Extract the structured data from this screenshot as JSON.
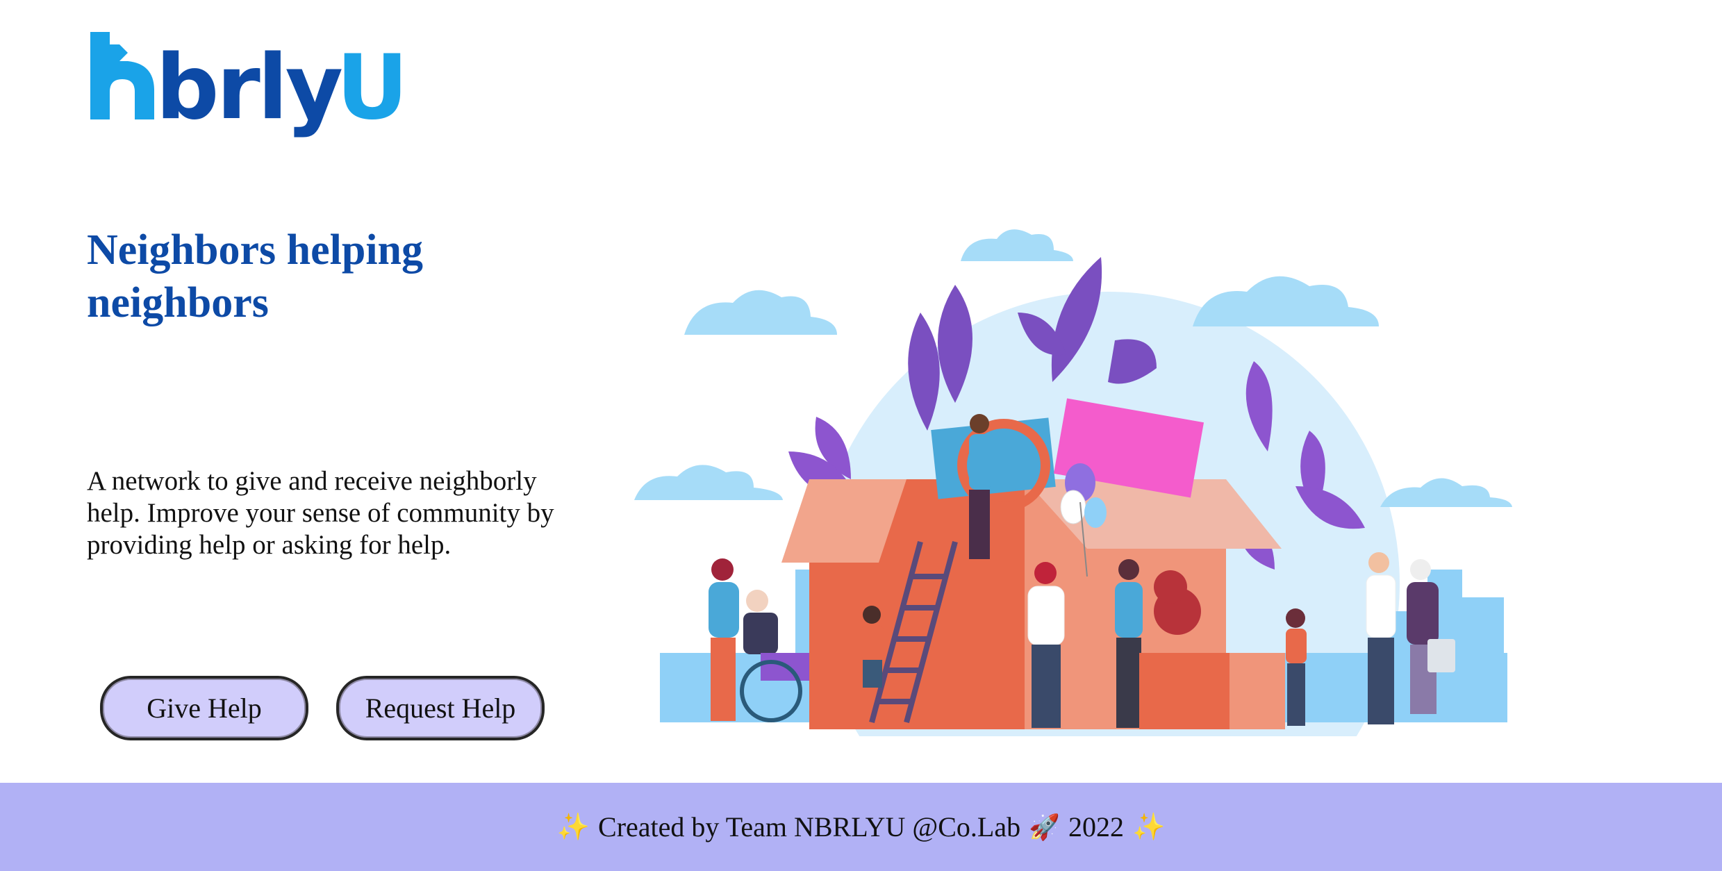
{
  "brand": {
    "logo_text": "nbrlyU",
    "primary_color": "#0d4aa6",
    "accent_color": "#1aa3e8"
  },
  "hero": {
    "title": "Neighbors helping neighbors",
    "description": "A network to give and receive neighborly help. Improve your sense of community by providing help or asking for help."
  },
  "actions": {
    "give_help_label": "Give Help",
    "request_help_label": "Request Help",
    "button_color": "#d1cdfb"
  },
  "illustration": {
    "subject": "community-helping-illustration"
  },
  "footer": {
    "sparkle_left": "✨",
    "text": "Created by Team NBRLYU @Co.Lab",
    "rocket": "🚀",
    "year": "2022",
    "sparkle_right": "✨",
    "background_color": "#b1b1f5"
  }
}
